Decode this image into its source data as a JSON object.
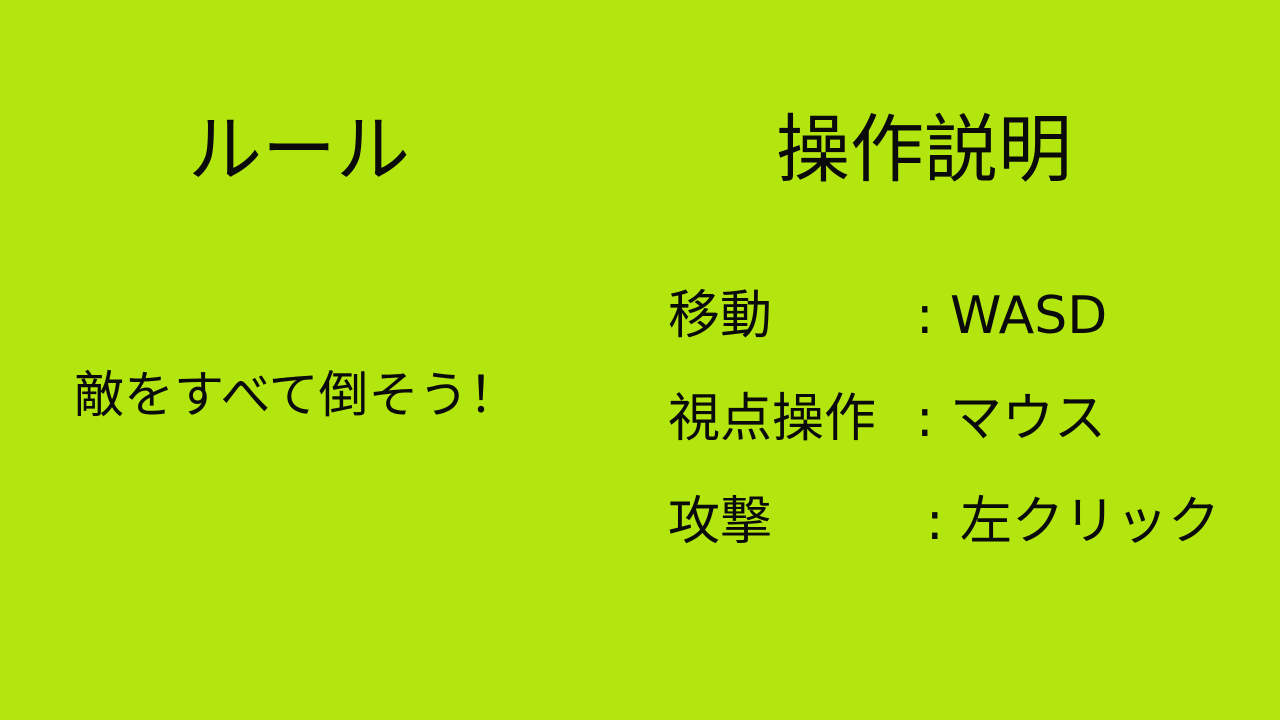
{
  "rules": {
    "title": "ルール",
    "text": "敵をすべて倒そう！"
  },
  "controls": {
    "title": "操作説明",
    "items": [
      {
        "label": "移動",
        "value": ": WASD"
      },
      {
        "label": "視点操作",
        "value": ": マウス"
      },
      {
        "label": "攻撃",
        "value": ": 左クリック"
      }
    ]
  },
  "colors": {
    "background": "#b3e50f",
    "text": "#0a0a0a"
  }
}
